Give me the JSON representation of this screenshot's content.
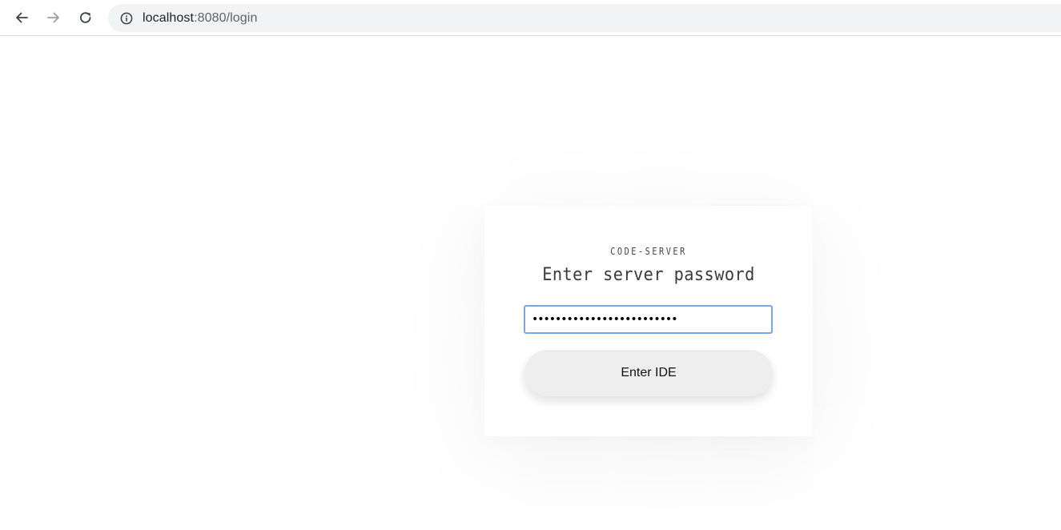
{
  "browser": {
    "url_host": "localhost",
    "url_rest": ":8080/login",
    "icons": {
      "back": "arrow-left-icon",
      "forward": "arrow-right-icon",
      "reload": "reload-icon",
      "site_info": "info-icon"
    }
  },
  "login": {
    "brand": "CODE-SERVER",
    "heading": "Enter server password",
    "password_value": "•••••••••••••••••••••••••",
    "submit_label": "Enter IDE"
  },
  "colors": {
    "input_focus_border": "#7aa6e8",
    "button_bg": "#eeeeee",
    "omnibox_bg": "#f1f3f4"
  }
}
